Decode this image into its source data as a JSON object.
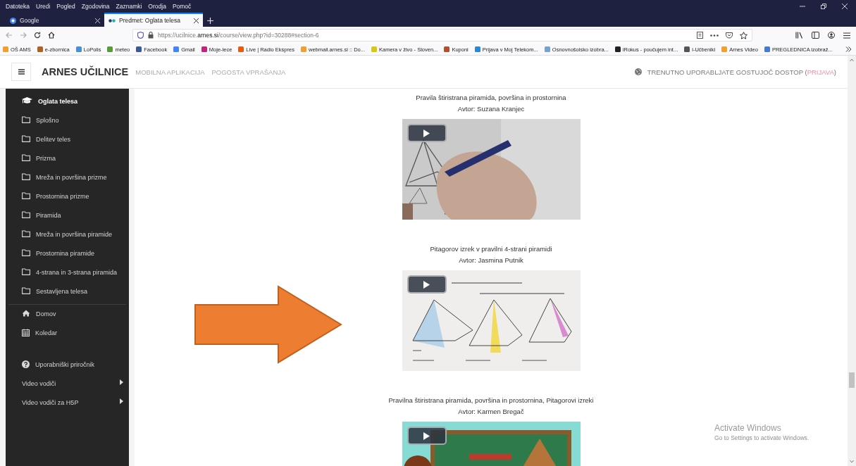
{
  "browser": {
    "menu": [
      "Datoteka",
      "Uredi",
      "Pogled",
      "Zgodovina",
      "Zaznamki",
      "Orodja",
      "Pomoč"
    ],
    "tabs": [
      {
        "title": "Google",
        "selected": false
      },
      {
        "title": "Predmet: Oglata telesa",
        "selected": true
      }
    ],
    "url": {
      "prefix": "https://ucilnice.",
      "domain": "arnes.si",
      "path": "/course/view.php?id=30288#section-6"
    },
    "bookmarks": [
      "OŠ AMS",
      "e-zbornica",
      "LoPolis",
      "meteo",
      "Facebook",
      "Gmail",
      "Moje-lece",
      "Live | Radio Ekspres",
      "webmail.arnes.si :: Do...",
      "Kamera v živo - Sloven...",
      "Kuponi",
      "Prijava v Moj Telekom...",
      "Osnovnošolsko izobra...",
      "iRokus - poučujem int...",
      "i-Učbeniki",
      "Arnes Video",
      "PREGLEDNICA izobraž..."
    ]
  },
  "header": {
    "brand": "ARNES UČILNICE",
    "links": [
      "MOBILNA APLIKACIJA",
      "POGOSTA VPRAŠANJA"
    ],
    "guest_text": "TRENUTNO UPORABLJATE GOSTUJOČ DOSTOP (",
    "login_link": "PRIJAVA",
    "guest_text_end": ")"
  },
  "sidebar": {
    "groups": [
      [
        {
          "label": "Oglata telesa",
          "kind": "course"
        },
        {
          "label": "Splošno",
          "kind": "folder"
        },
        {
          "label": "Delitev teles",
          "kind": "folder"
        },
        {
          "label": "Prizma",
          "kind": "folder"
        },
        {
          "label": "Mreža in površina prizme",
          "kind": "folder"
        },
        {
          "label": "Prostornina prizme",
          "kind": "folder"
        },
        {
          "label": "Piramida",
          "kind": "folder"
        },
        {
          "label": "Mreža in površina piramide",
          "kind": "folder"
        },
        {
          "label": "Prostornina piramide",
          "kind": "folder"
        },
        {
          "label": "4-strana in 3-strana piramida",
          "kind": "folder"
        },
        {
          "label": "Sestavljena telesa",
          "kind": "folder"
        }
      ],
      [
        {
          "label": "Domov",
          "kind": "home"
        },
        {
          "label": "Koledar",
          "kind": "calendar"
        }
      ],
      [
        {
          "label": "Uporabniški priročnik",
          "kind": "help"
        },
        {
          "label": "Video vodiči",
          "kind": "submenu"
        },
        {
          "label": "Video vodiči za H5P",
          "kind": "submenu"
        }
      ]
    ]
  },
  "videos": [
    {
      "title": "Pravila štiristrana piramida, površina in prostornina",
      "author": "Avtor: Suzana Kranjec"
    },
    {
      "title": "Pitagorov izrek v pravilni 4-strani piramidi",
      "author": "Avtor: Jasmina Putnik"
    },
    {
      "title": "Pravilna štiristrana piramida, površina in prostornina, Pitagorovi izreki",
      "author": "Avtor: Karmen Bregač"
    }
  ],
  "os_notice": {
    "title": "Activate Windows",
    "text": "Go to Settings to activate Windows."
  }
}
